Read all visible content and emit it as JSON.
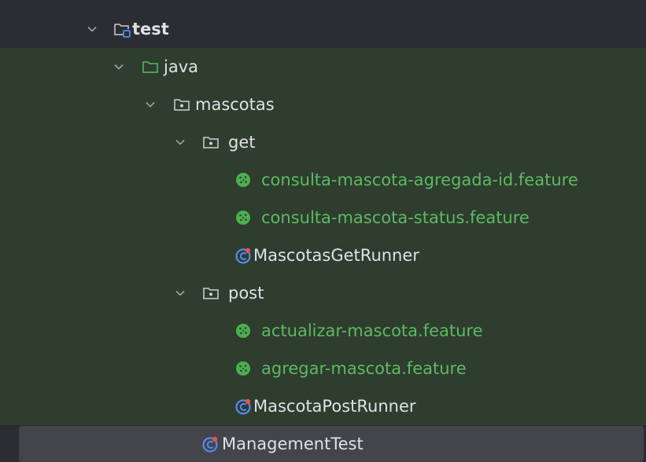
{
  "tree": {
    "test": {
      "label": "test",
      "chevron": "chevron-down-icon",
      "icon": "test-root-folder-icon"
    },
    "java": {
      "label": "java",
      "chevron": "chevron-down-icon",
      "icon": "folder-icon"
    },
    "mascotas": {
      "label": "mascotas",
      "chevron": "chevron-down-icon",
      "icon": "package-icon"
    },
    "get": {
      "label": "get",
      "chevron": "chevron-down-icon",
      "icon": "package-icon"
    },
    "get_files": [
      {
        "label": "consulta-mascota-agregada-id.feature",
        "icon": "cucumber-feature-icon"
      },
      {
        "label": "consulta-mascota-status.feature",
        "icon": "cucumber-feature-icon"
      },
      {
        "label": "MascotasGetRunner",
        "icon": "java-class-test-icon"
      }
    ],
    "post": {
      "label": "post",
      "chevron": "chevron-down-icon",
      "icon": "package-icon"
    },
    "post_files": [
      {
        "label": "actualizar-mascota.feature",
        "icon": "cucumber-feature-icon"
      },
      {
        "label": "agregar-mascota.feature",
        "icon": "cucumber-feature-icon"
      },
      {
        "label": "MascotaPostRunner",
        "icon": "java-class-test-icon"
      }
    ],
    "management": {
      "label": "ManagementTest",
      "icon": "java-class-test-icon"
    }
  },
  "colors": {
    "background": "#2b2d30",
    "test_scope_background": "#2e3d2e",
    "selected_row": "#43454a",
    "feature_text": "#5fb865",
    "default_text": "#dfe1e5",
    "class_icon": "#548af7",
    "test_badge": "#e05555"
  }
}
